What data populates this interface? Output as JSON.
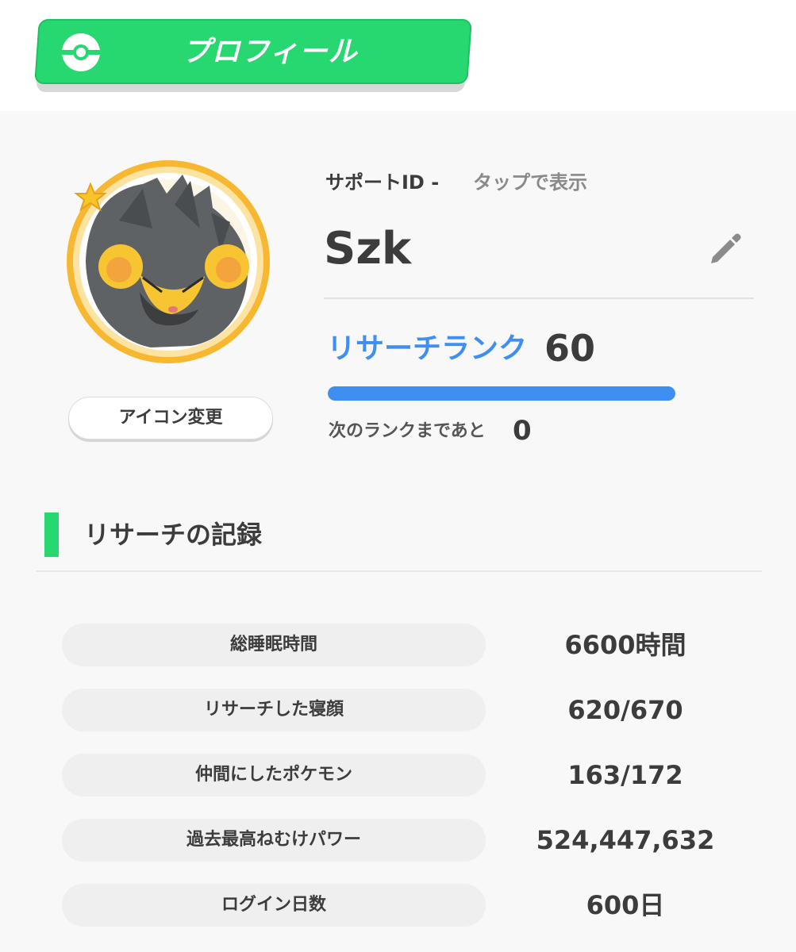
{
  "header": {
    "title": "プロフィール",
    "icon": "pokeball-icon"
  },
  "profile": {
    "support_id_label": "サポートID -",
    "support_id_link": "タップで表示",
    "name": "Szk",
    "change_icon_button": "アイコン変更",
    "avatar": "luxray-avatar",
    "edit_icon": "pencil-icon"
  },
  "rank": {
    "label": "リサーチランク",
    "value": "60",
    "progress": 1.0,
    "next_label": "次のランクまであと",
    "next_value": "0"
  },
  "records": {
    "title": "リサーチの記録",
    "items": [
      {
        "label": "総睡眠時間",
        "value": "6600時間"
      },
      {
        "label": "リサーチした寝顔",
        "value": "620/670"
      },
      {
        "label": "仲間にしたポケモン",
        "value": "163/172"
      },
      {
        "label": "過去最高ねむけパワー",
        "value": "524,447,632"
      },
      {
        "label": "ログイン日数",
        "value": "600日"
      }
    ]
  },
  "colors": {
    "accent_green": "#26d86f",
    "rank_blue": "#3f8ef2",
    "avatar_ring": "#f5b82e"
  }
}
